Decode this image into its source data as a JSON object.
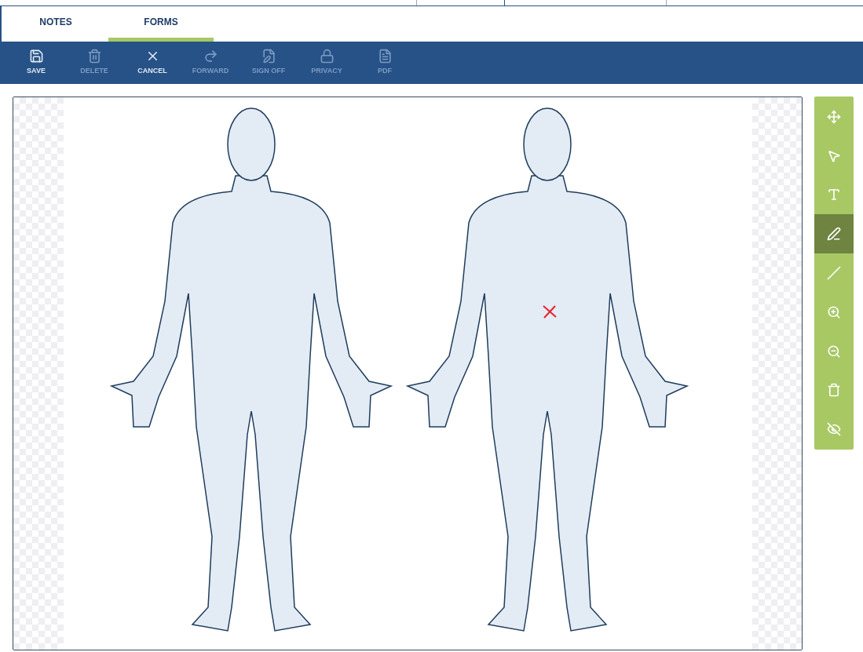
{
  "tabs": [
    {
      "label": "NOTES",
      "selected": false
    },
    {
      "label": "FORMS",
      "selected": true
    }
  ],
  "toolbar": [
    {
      "kind": "save",
      "label": "SAVE",
      "disabled": false
    },
    {
      "kind": "delete",
      "label": "DELETE",
      "disabled": true
    },
    {
      "kind": "cancel",
      "label": "CANCEL",
      "disabled": false
    },
    {
      "kind": "forward",
      "label": "FORWARD",
      "disabled": true
    },
    {
      "kind": "signoff",
      "label": "SIGN OFF",
      "disabled": true
    },
    {
      "kind": "privacy",
      "label": "PRIVACY",
      "disabled": true
    },
    {
      "kind": "pdf",
      "label": "PDF",
      "disabled": true
    }
  ],
  "tools": [
    {
      "kind": "move",
      "selected": false
    },
    {
      "kind": "select",
      "selected": false
    },
    {
      "kind": "text",
      "selected": false
    },
    {
      "kind": "pen",
      "selected": true
    },
    {
      "kind": "line",
      "selected": false
    },
    {
      "kind": "zoom-in",
      "selected": false
    },
    {
      "kind": "zoom-out",
      "selected": false
    },
    {
      "kind": "delete",
      "selected": false
    },
    {
      "kind": "hide",
      "selected": false
    }
  ]
}
